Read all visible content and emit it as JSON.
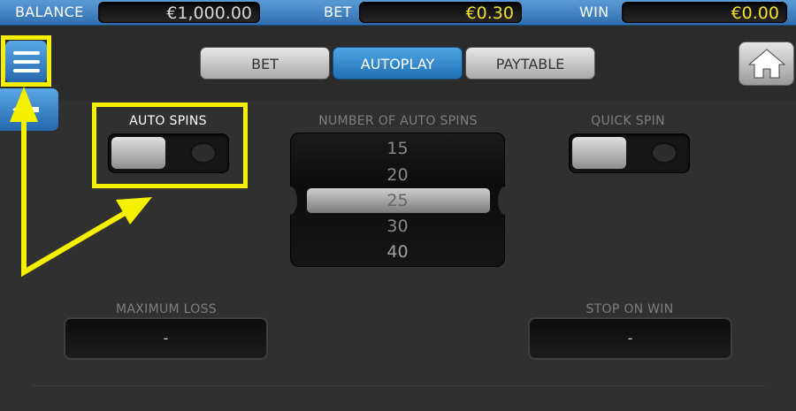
{
  "header": {
    "balance_label": "BALANCE",
    "balance_value": "€1,000.00",
    "bet_label": "BET",
    "bet_value": "€0.30",
    "win_label": "WIN",
    "win_value": "€0.00"
  },
  "tabs": [
    {
      "label": "BET",
      "active": false
    },
    {
      "label": "AUTOPLAY",
      "active": true
    },
    {
      "label": "PAYTABLE",
      "active": false
    }
  ],
  "icons": {
    "menu": "menu-icon",
    "back": "back-arrow-icon",
    "home": "home-icon"
  },
  "autoplay": {
    "auto_spins_label": "AUTO SPINS",
    "auto_spins_on": false,
    "number_label": "NUMBER OF AUTO SPINS",
    "spin_options": [
      "15",
      "20",
      "25",
      "30",
      "40"
    ],
    "selected_option": "25",
    "quick_spin_label": "QUICK SPIN",
    "quick_spin_on": false,
    "maximum_loss_label": "MAXIMUM LOSS",
    "maximum_loss_value": "-",
    "stop_on_win_label": "STOP ON WIN",
    "stop_on_win_value": "-"
  },
  "colors": {
    "accent_blue": "#2f6fb0",
    "value_yellow": "#f4e02a",
    "highlight_yellow": "#f5f000"
  }
}
